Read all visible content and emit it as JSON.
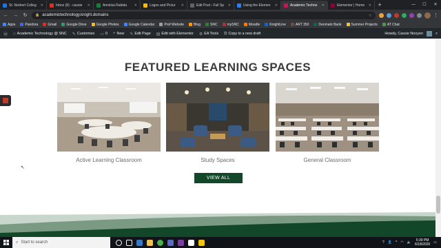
{
  "tabs": [
    {
      "title": "St. Norbert Colleg",
      "color": "#1a73e8"
    },
    {
      "title": "Inbox (8) - cassie",
      "color": "#d93025"
    },
    {
      "title": "Annicka Rabida",
      "color": "#188038"
    },
    {
      "title": "Logos and Pictur",
      "color": "#fbbc04"
    },
    {
      "title": "Edit Post ‹ Full Sp",
      "color": "#5f6368"
    },
    {
      "title": "Using the Elemen",
      "color": "#2d7ff9"
    },
    {
      "title": "Academic Techno",
      "color": "#c2185b"
    },
    {
      "title": "Elementor | Home",
      "color": "#92003b"
    }
  ],
  "active_tab_index": 6,
  "address": "academictechnology.knight.domains",
  "bookmarks": [
    {
      "label": "Apps",
      "color": "#4285f4"
    },
    {
      "label": "Pandora",
      "color": "#3668ff"
    },
    {
      "label": "Gmail",
      "color": "#d93025"
    },
    {
      "label": "Google Drive",
      "color": "#1fa463"
    },
    {
      "label": "Google Photos",
      "color": "#fbbc04"
    },
    {
      "label": "Google Calendar",
      "color": "#4285f4"
    },
    {
      "label": "Prof Website",
      "color": "#9e9e9e"
    },
    {
      "label": "Blog",
      "color": "#ff9800"
    },
    {
      "label": "SNC",
      "color": "#2e7d32"
    },
    {
      "label": "mySNC",
      "color": "#c62828"
    },
    {
      "label": "Moodle",
      "color": "#f57c00"
    },
    {
      "label": "KnightLine",
      "color": "#1565c0"
    },
    {
      "label": "ART 350",
      "color": "#6d4c41"
    },
    {
      "label": "Denmark Bank",
      "color": "#00695c"
    },
    {
      "label": "Summer Projects",
      "color": "#fbc02d"
    },
    {
      "label": "AT Chat",
      "color": "#43a047"
    }
  ],
  "wp_admin": {
    "site": "Academic Technology @ SNC",
    "customize": "Customize",
    "comments": "0",
    "new": "New",
    "edit_page": "Edit Page",
    "elementor": "Edit with Elementor",
    "ea_tools": "EA Tools",
    "copy": "Copy to a new draft",
    "howdy": "Howdy, Cassie Nooyen"
  },
  "section_title": "FEATURED LEARNING SPACES",
  "spaces": [
    {
      "caption": "Active Learning Classroom"
    },
    {
      "caption": "Study Spaces"
    },
    {
      "caption": "General Classroom"
    }
  ],
  "view_all": "VIEW ALL",
  "taskbar": {
    "search_placeholder": "Start to search",
    "time": "5:39 PM",
    "date": "6/18/2020"
  },
  "colors": {
    "brand_green": "#13472a",
    "heading": "#3b3b3b"
  }
}
